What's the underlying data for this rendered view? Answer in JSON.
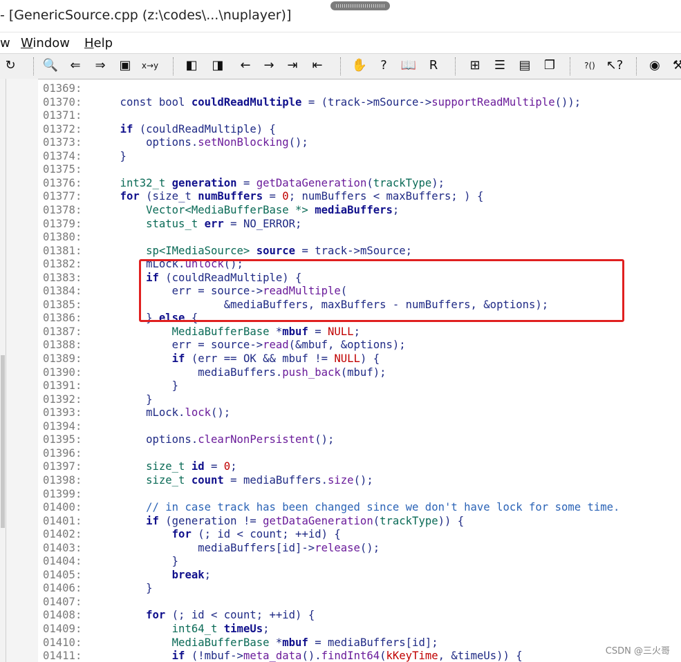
{
  "window": {
    "title": "- [GenericSource.cpp (z:\\codes\\...\\nuplayer)]"
  },
  "menu": [
    {
      "label": "w"
    },
    {
      "label": "Window"
    },
    {
      "label": "Help"
    }
  ],
  "toolbar": {
    "buttons": [
      {
        "name": "redo-icon",
        "glyph": "↻"
      },
      {
        "name": "find-icon",
        "glyph": "🔍"
      },
      {
        "name": "find-prev-icon",
        "glyph": "⇐"
      },
      {
        "name": "find-next-icon",
        "glyph": "⇒"
      },
      {
        "name": "find-files-icon",
        "glyph": "▣"
      },
      {
        "name": "replace-icon",
        "glyph": "x→y"
      },
      {
        "name": "bookmark-prev-icon",
        "glyph": "◧"
      },
      {
        "name": "bookmark-next-icon",
        "glyph": "◨"
      },
      {
        "name": "back-icon",
        "glyph": "←"
      },
      {
        "name": "forward-icon",
        "glyph": "→"
      },
      {
        "name": "jump-icon",
        "glyph": "⇥"
      },
      {
        "name": "jump-back-icon",
        "glyph": "⇤"
      },
      {
        "name": "symbol-icon",
        "glyph": "✋"
      },
      {
        "name": "lookup-icon",
        "glyph": "?"
      },
      {
        "name": "book-icon",
        "glyph": "📖"
      },
      {
        "name": "relation-icon",
        "glyph": "R"
      },
      {
        "name": "layout-1-icon",
        "glyph": "⊞"
      },
      {
        "name": "layout-2-icon",
        "glyph": "☰"
      },
      {
        "name": "layout-3-icon",
        "glyph": "▤"
      },
      {
        "name": "layout-4-icon",
        "glyph": "❐"
      },
      {
        "name": "help-call-icon",
        "glyph": "?()"
      },
      {
        "name": "context-help-icon",
        "glyph": "↖?"
      },
      {
        "name": "toggle-icon",
        "glyph": "◉"
      },
      {
        "name": "extra-icon",
        "glyph": "⚒"
      }
    ]
  },
  "code": {
    "lines": [
      {
        "n": "01369:",
        "html": ""
      },
      {
        "n": "01370:",
        "html": "    const bool <span class='id'>couldReadMultiple</span> = (track-&gt;mSource-&gt;<span class='fn'>supportReadMultiple</span>());"
      },
      {
        "n": "01371:",
        "html": ""
      },
      {
        "n": "01372:",
        "html": "    <span class='kw'>if</span> (couldReadMultiple) {"
      },
      {
        "n": "01373:",
        "html": "        options.<span class='fn'>setNonBlocking</span>();"
      },
      {
        "n": "01374:",
        "html": "    }"
      },
      {
        "n": "01375:",
        "html": ""
      },
      {
        "n": "01376:",
        "html": "    <span class='ty'>int32_t</span> <span class='id'>generation</span> = <span class='fn'>getDataGeneration</span>(<span class='ty'>trackType</span>);"
      },
      {
        "n": "01377:",
        "html": "    <span class='kw'>for</span> (size_t <span class='id'>numBuffers</span> = <span class='num'>0</span>; numBuffers &lt; maxBuffers; ) {"
      },
      {
        "n": "01378:",
        "html": "        <span class='ty'>Vector&lt;MediaBufferBase *&gt;</span> <span class='id'>mediaBuffers</span>;"
      },
      {
        "n": "01379:",
        "html": "        <span class='ty'>status_t</span> <span class='id'>err</span> = NO_ERROR;"
      },
      {
        "n": "01380:",
        "html": ""
      },
      {
        "n": "01381:",
        "html": "        <span class='ty'>sp&lt;IMediaSource&gt;</span> <span class='id'>source</span> = track-&gt;mSource;"
      },
      {
        "n": "01382:",
        "html": "        mLock.<span class='fn'>unlock</span>();"
      },
      {
        "n": "01383:",
        "html": "        <span class='kw'>if</span> (couldReadMultiple) {"
      },
      {
        "n": "01384:",
        "html": "            err = source-&gt;<span class='fn'>readMultiple</span>("
      },
      {
        "n": "01385:",
        "html": "                    &amp;mediaBuffers, maxBuffers - numBuffers, &amp;options);"
      },
      {
        "n": "01386:",
        "html": "        } <span class='kw'>else</span> {"
      },
      {
        "n": "01387:",
        "html": "            <span class='ty'>MediaBufferBase</span> *<span class='id'>mbuf</span> = <span class='num'>NULL</span>;"
      },
      {
        "n": "01388:",
        "html": "            err = source-&gt;<span class='fn'>read</span>(&amp;mbuf, &amp;options);"
      },
      {
        "n": "01389:",
        "html": "            <span class='kw'>if</span> (err == OK &amp;&amp; mbuf != <span class='num'>NULL</span>) {"
      },
      {
        "n": "01390:",
        "html": "                mediaBuffers.<span class='fn'>push_back</span>(mbuf);"
      },
      {
        "n": "01391:",
        "html": "            }"
      },
      {
        "n": "01392:",
        "html": "        }"
      },
      {
        "n": "01393:",
        "html": "        mLock.<span class='fn'>lock</span>();"
      },
      {
        "n": "01394:",
        "html": ""
      },
      {
        "n": "01395:",
        "html": "        options.<span class='fn'>clearNonPersistent</span>();"
      },
      {
        "n": "01396:",
        "html": ""
      },
      {
        "n": "01397:",
        "html": "        <span class='ty'>size_t</span> <span class='id'>id</span> = <span class='num'>0</span>;"
      },
      {
        "n": "01398:",
        "html": "        <span class='ty'>size_t</span> <span class='id'>count</span> = mediaBuffers.<span class='fn'>size</span>();"
      },
      {
        "n": "01399:",
        "html": ""
      },
      {
        "n": "01400:",
        "html": "        <span class='cm'>// in case track has been changed since we don't have lock for some time.</span>"
      },
      {
        "n": "01401:",
        "html": "        <span class='kw'>if</span> (generation != <span class='fn'>getDataGeneration</span>(<span class='ty'>trackType</span>)) {"
      },
      {
        "n": "01402:",
        "html": "            <span class='kw'>for</span> (; id &lt; count; ++id) {"
      },
      {
        "n": "01403:",
        "html": "                mediaBuffers[id]-&gt;<span class='fn'>release</span>();"
      },
      {
        "n": "01404:",
        "html": "            }"
      },
      {
        "n": "01405:",
        "html": "            <span class='kw'>break</span>;"
      },
      {
        "n": "01406:",
        "html": "        }"
      },
      {
        "n": "01407:",
        "html": ""
      },
      {
        "n": "01408:",
        "html": "        <span class='kw'>for</span> (; id &lt; count; ++id) {"
      },
      {
        "n": "01409:",
        "html": "            <span class='ty'>int64_t</span> <span class='id'>timeUs</span>;"
      },
      {
        "n": "01410:",
        "html": "            <span class='ty'>MediaBufferBase</span> *<span class='id'>mbuf</span> = mediaBuffers[id];"
      },
      {
        "n": "01411:",
        "html": "            <span class='kw'>if</span> (!mbuf-&gt;<span class='fn'>meta_data</span>().<span class='fn'>findInt64</span>(<span class='num'>kKeyTime</span>, &amp;timeUs)) {"
      }
    ]
  },
  "watermark": "CSDN @三火哥",
  "colors": {
    "highlight_box": "#e02020",
    "keyword": "#10108c",
    "comment": "#2b63b6",
    "number": "#c00000"
  }
}
